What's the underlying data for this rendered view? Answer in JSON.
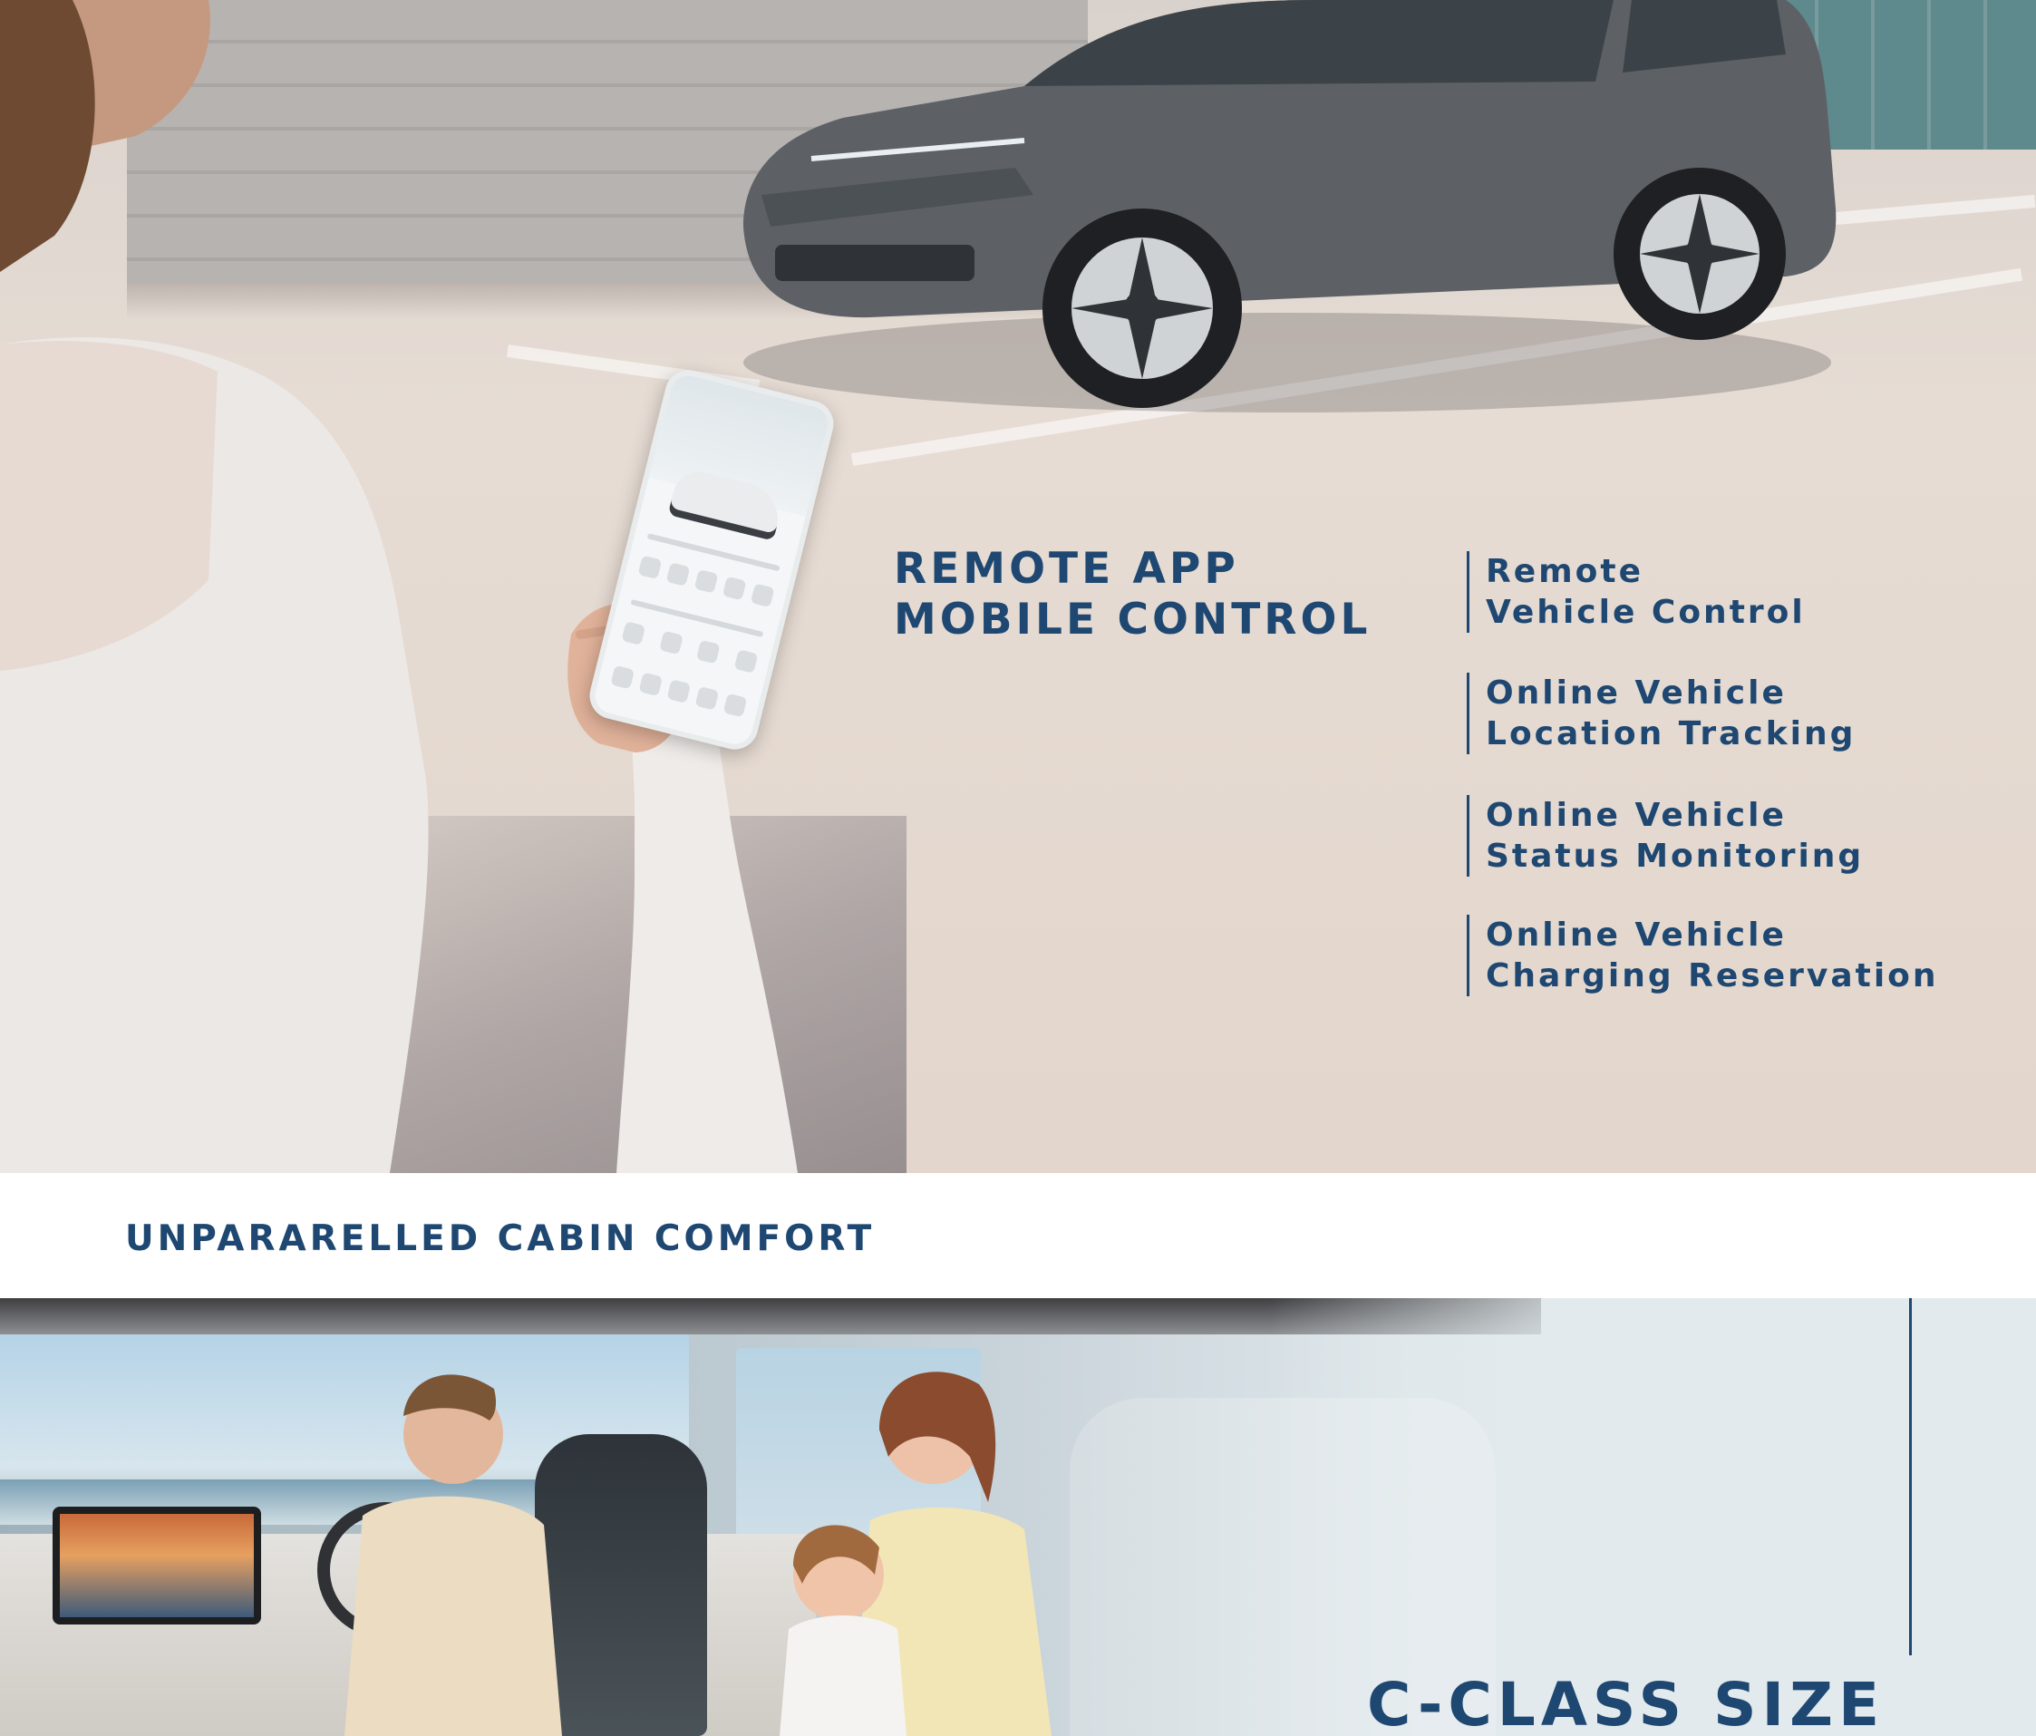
{
  "hero": {
    "title_line1": "REMOTE APP",
    "title_line2": "MOBILE CONTROL",
    "features": [
      {
        "text": "Remote\nVehicle Control"
      },
      {
        "text": "Online Vehicle\nLocation Tracking"
      },
      {
        "text": "Online Vehicle\nStatus Monitoring"
      },
      {
        "text": "Online Vehicle\nCharging Reservation"
      }
    ]
  },
  "banner": {
    "title": "UNPARARELLED CABIN COMFORT"
  },
  "cabin": {
    "title": "C-CLASS SIZE"
  },
  "colors": {
    "accent": "#1e4771",
    "hero_floor": "#e3d6cc",
    "cabin_panel": "#e2eaed"
  }
}
